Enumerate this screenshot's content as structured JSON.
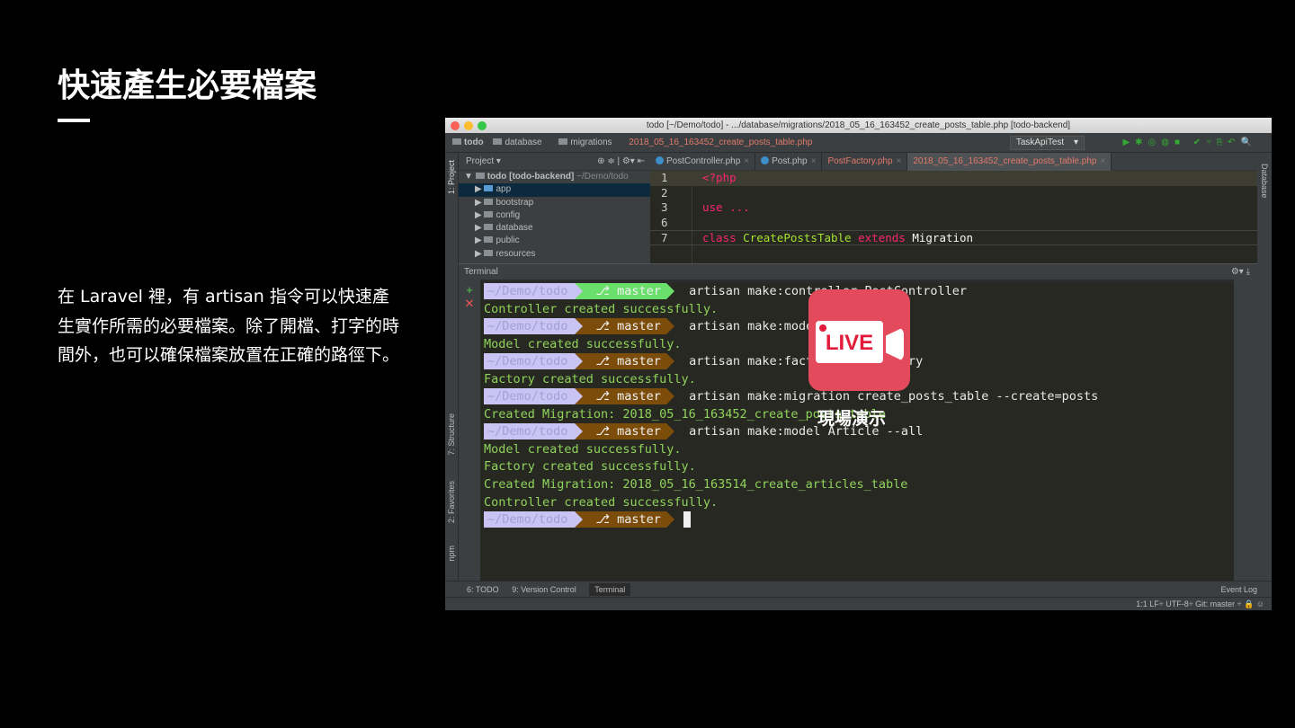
{
  "slide": {
    "title": "快速產生必要檔案",
    "paragraph": "在 Laravel 裡，有 artisan 指令可以快速產生實作所需的必要檔案。除了開檔、打字的時間外，也可以確保檔案放置在正確的路徑下。"
  },
  "ide": {
    "window_title": "todo [~/Demo/todo] - .../database/migrations/2018_05_16_163452_create_posts_table.php [todo-backend]",
    "breadcrumb": [
      "todo",
      "database",
      "migrations",
      "2018_05_16_163452_create_posts_table.php"
    ],
    "run_config": "TaskApiTest",
    "left_tools": [
      "1: Project",
      "7: Structure",
      "2: Favorites",
      "npm"
    ],
    "right_tools": [
      "Database"
    ],
    "project": {
      "header": "Project",
      "root": "todo [todo-backend]",
      "root_path": "~/Demo/todo",
      "items": [
        "app",
        "bootstrap",
        "config",
        "database",
        "public",
        "resources"
      ]
    },
    "tabs": [
      "PostController.php",
      "Post.php",
      "PostFactory.php",
      "2018_05_16_163452_create_posts_table.php"
    ],
    "code": [
      {
        "n": "1",
        "t": "<?php"
      },
      {
        "n": "2",
        "t": ""
      },
      {
        "n": "3",
        "t": "use ..."
      },
      {
        "n": "6",
        "t": ""
      },
      {
        "n": "7",
        "a": "class",
        "b": "CreatePostsTable",
        "c": "extends",
        "d": "Migration"
      }
    ],
    "terminal": {
      "header": "Terminal",
      "path": "~/Demo/todo",
      "branch": "master",
      "lines": [
        {
          "type": "cmd",
          "cmd": "artisan make:controller PostController",
          "active": true
        },
        {
          "type": "out",
          "text": "Controller created successfully."
        },
        {
          "type": "cmd",
          "cmd": "artisan make:model Post"
        },
        {
          "type": "out",
          "text": "Model created successfully."
        },
        {
          "type": "cmd",
          "cmd": "artisan make:factory PostFactory"
        },
        {
          "type": "out",
          "text": "Factory created successfully."
        },
        {
          "type": "cmd",
          "cmd": "artisan make:migration create_posts_table --create=posts"
        },
        {
          "type": "out",
          "text": "Created Migration: 2018_05_16_163452_create_posts_table"
        },
        {
          "type": "cmd",
          "cmd": "artisan make:model Article --all"
        },
        {
          "type": "out",
          "text": "Model created successfully."
        },
        {
          "type": "out",
          "text": "Factory created successfully."
        },
        {
          "type": "out",
          "text": "Created Migration: 2018_05_16_163514_create_articles_table"
        },
        {
          "type": "out",
          "text": "Controller created successfully."
        },
        {
          "type": "cmd",
          "cmd": "",
          "cursor": true
        }
      ]
    },
    "bottom_tabs": [
      "6: TODO",
      "9: Version Control",
      "Terminal"
    ],
    "event_log": "Event Log",
    "status": "1:1  LF÷  UTF-8÷  Git: master ÷"
  },
  "live": {
    "badge": "LIVE",
    "caption": "現場演示"
  }
}
